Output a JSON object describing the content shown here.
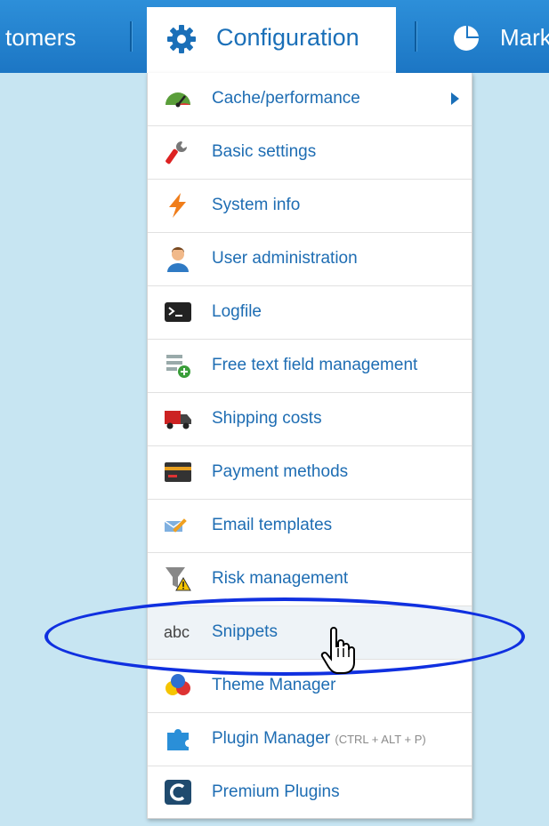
{
  "topnav": {
    "left_label": "tomers",
    "active_tab": "Configuration",
    "right_label": "Mark"
  },
  "menu": {
    "items": [
      {
        "label": "Cache/performance",
        "icon": "speedometer-icon",
        "has_submenu": true
      },
      {
        "label": "Basic settings",
        "icon": "wrench-icon"
      },
      {
        "label": "System info",
        "icon": "lightning-icon"
      },
      {
        "label": "User administration",
        "icon": "user-icon"
      },
      {
        "label": "Logfile",
        "icon": "terminal-icon"
      },
      {
        "label": "Free text field management",
        "icon": "add-field-icon"
      },
      {
        "label": "Shipping costs",
        "icon": "truck-icon"
      },
      {
        "label": "Payment methods",
        "icon": "credit-card-icon"
      },
      {
        "label": "Email templates",
        "icon": "email-pencil-icon"
      },
      {
        "label": "Risk management",
        "icon": "funnel-warning-icon"
      },
      {
        "label": "Snippets",
        "icon": "abc-icon",
        "icon_text": "abc",
        "state": "hover"
      },
      {
        "label": "Theme Manager",
        "icon": "color-circles-icon"
      },
      {
        "label": "Plugin Manager",
        "shortcut": "(CTRL + ALT + P)",
        "icon": "puzzle-icon"
      },
      {
        "label": "Premium Plugins",
        "icon": "shopware-logo-icon"
      }
    ]
  },
  "colors": {
    "nav_bg": "#2183cf",
    "link_text": "#1e6db3",
    "highlight_ellipse": "#1030e0",
    "page_bg": "#c7e5f2"
  }
}
